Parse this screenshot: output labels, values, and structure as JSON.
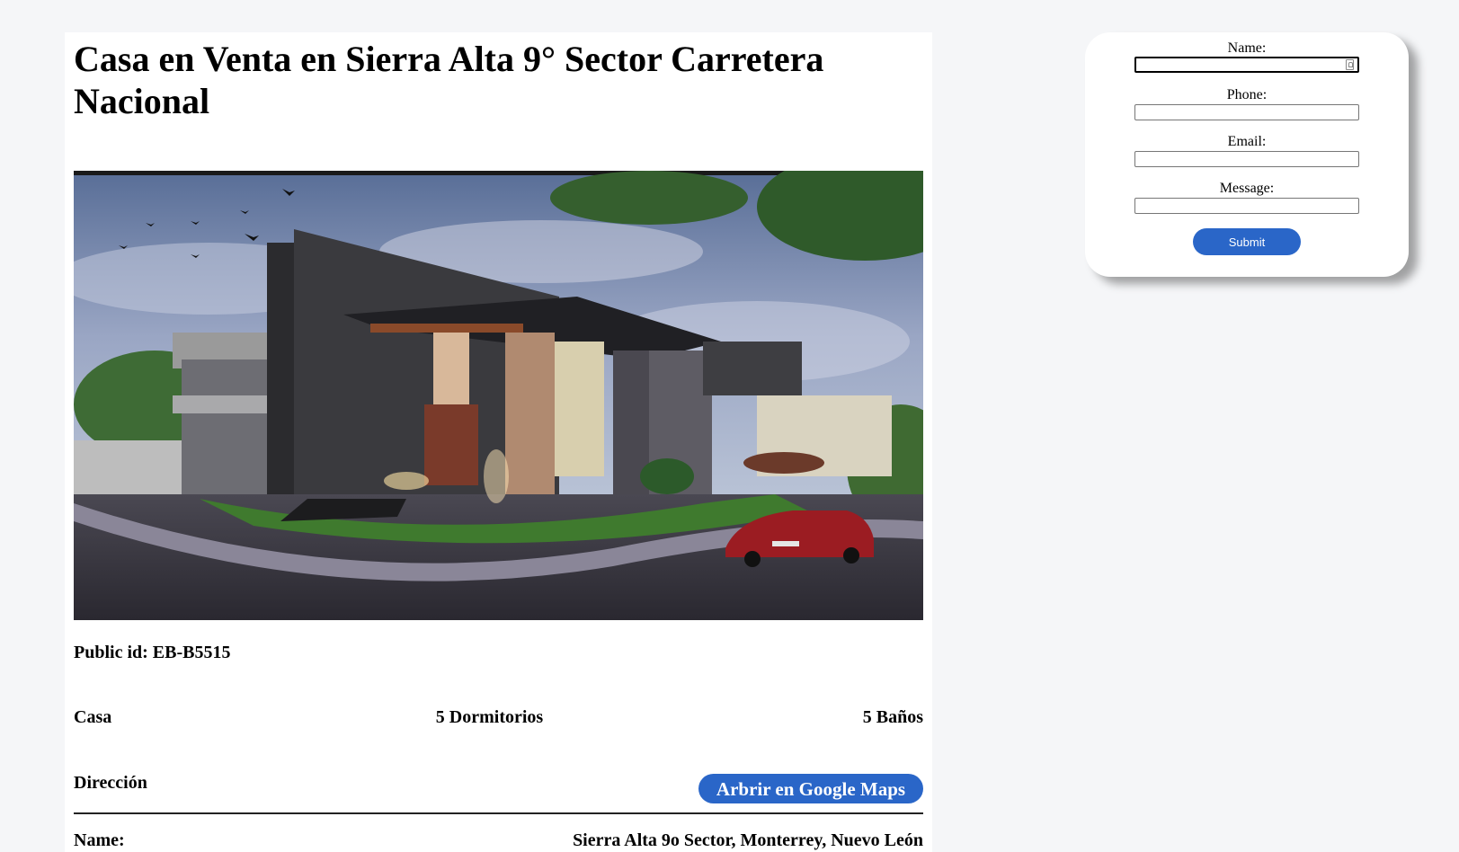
{
  "listing": {
    "title": "Casa en Venta en Sierra Alta 9° Sector Carretera Nacional",
    "public_id_label": "Public id:",
    "public_id_value": "EB-B5515",
    "features": {
      "type": "Casa",
      "bedrooms": "5 Dormitorios",
      "bathrooms": "5 Baños"
    },
    "address_heading": "Dirección",
    "maps_button_label": "Arbrir en Google Maps",
    "name_label": "Name:",
    "address_value": "Sierra Alta 9o Sector, Monterrey, Nuevo León"
  },
  "contact_form": {
    "name_label": "Name:",
    "phone_label": "Phone:",
    "email_label": "Email:",
    "message_label": "Message:",
    "name_value": "",
    "phone_value": "",
    "email_value": "",
    "message_value": "",
    "submit_label": "Submit"
  },
  "colors": {
    "accent": "#2a66c8",
    "page_background": "#f5f6f8",
    "card_background": "#ffffff"
  }
}
